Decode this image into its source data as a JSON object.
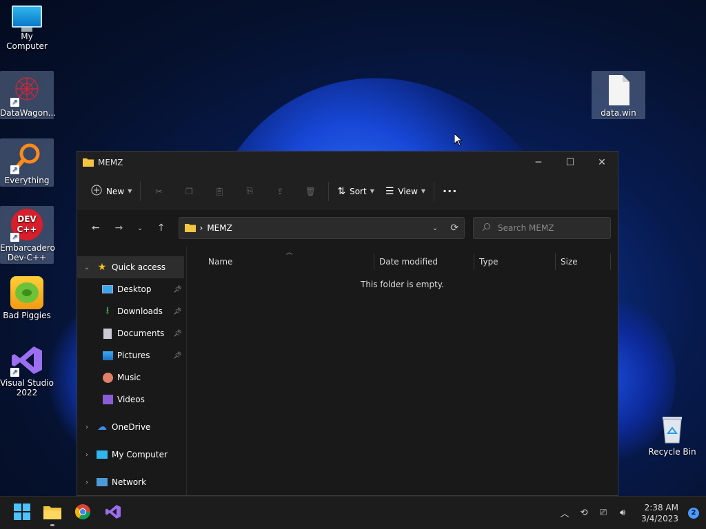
{
  "desktop": {
    "icons": [
      {
        "label": "My Computer"
      },
      {
        "label": "DataWagon..."
      },
      {
        "label": "Everything"
      },
      {
        "label": "Embarcadero Dev-C++"
      },
      {
        "label": "Bad Piggies"
      },
      {
        "label": "Visual Studio 2022"
      },
      {
        "label": "data.win"
      },
      {
        "label": "Recycle Bin"
      }
    ],
    "devcpp_text": "DEV C++"
  },
  "window": {
    "title": "MEMZ",
    "toolbar": {
      "new_label": "New",
      "sort_label": "Sort",
      "view_label": "View",
      "more_label": "···"
    },
    "address": {
      "crumb": "MEMZ",
      "separator": "›"
    },
    "search": {
      "placeholder": "Search MEMZ"
    },
    "nav": {
      "quick_access": "Quick access",
      "items": [
        {
          "label": "Desktop"
        },
        {
          "label": "Downloads"
        },
        {
          "label": "Documents"
        },
        {
          "label": "Pictures"
        },
        {
          "label": "Music"
        },
        {
          "label": "Videos"
        }
      ],
      "roots": [
        {
          "label": "OneDrive"
        },
        {
          "label": "My Computer"
        },
        {
          "label": "Network"
        }
      ]
    },
    "columns": [
      "Name",
      "Date modified",
      "Type",
      "Size"
    ],
    "empty_message": "This folder is empty."
  },
  "taskbar": {
    "time": "2:38 AM",
    "date": "3/4/2023",
    "notification_count": "2"
  },
  "colors": {
    "accent": "#4c9bff",
    "window_bg": "#191919",
    "folder": "#f4c542"
  }
}
